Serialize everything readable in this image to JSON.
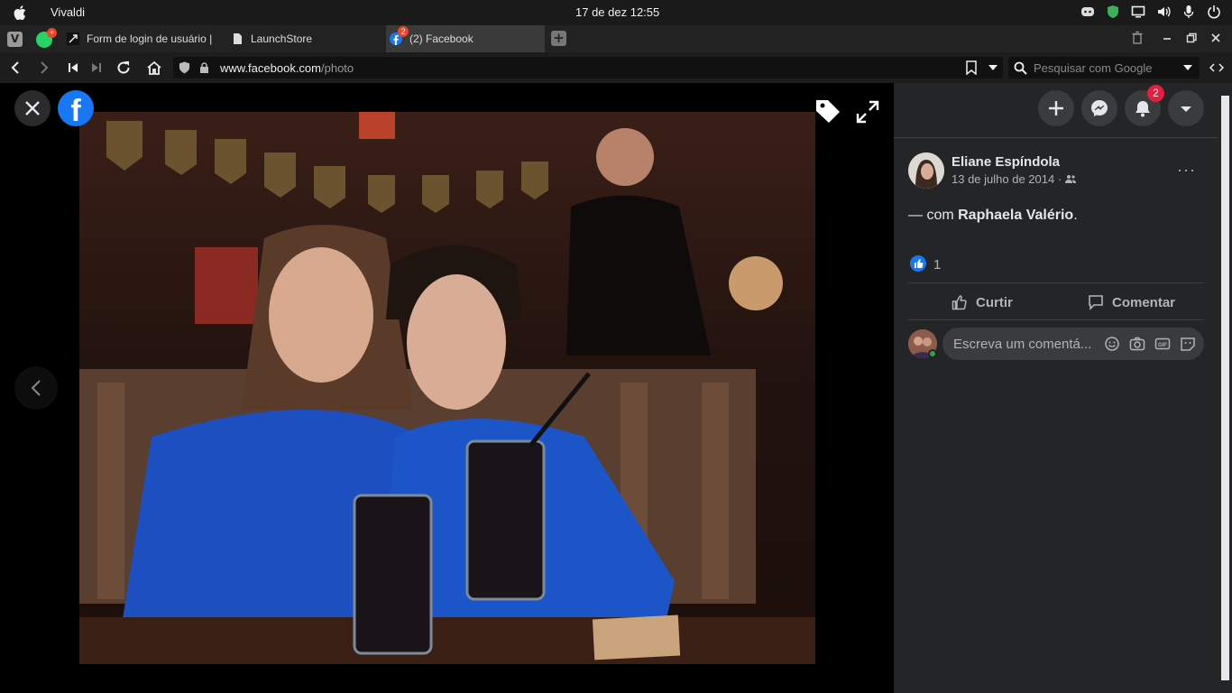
{
  "os": {
    "app_name": "Vivaldi",
    "clock": "17 de dez  12:55"
  },
  "tabs": [
    {
      "label": "Form de login de usuário | ",
      "active": false
    },
    {
      "label": "LaunchStore",
      "active": false
    },
    {
      "label": "(2) Facebook",
      "active": true,
      "badge": "2"
    }
  ],
  "whatsapp_badge": "+",
  "address": {
    "url_host": "www.facebook.com",
    "url_path": "/photo",
    "search_placeholder": "Pesquisar com Google"
  },
  "viewer": {
    "logo_letter": "f"
  },
  "panel": {
    "notifications_count": "2",
    "author": "Eliane Espíndola",
    "date": "13 de julho de 2014",
    "date_sep": " · ",
    "more": "···",
    "caption_prefix": "— com ",
    "tagged": "Raphaela Valério",
    "caption_suffix": ".",
    "like_count": "1",
    "like_label": "Curtir",
    "comment_label": "Comentar",
    "comment_placeholder": "Escreva um comentá..."
  },
  "colors": {
    "facebook_blue": "#1877f2",
    "panel_bg": "#242526",
    "badge_red": "#e41e3f",
    "online_green": "#31a24c"
  }
}
